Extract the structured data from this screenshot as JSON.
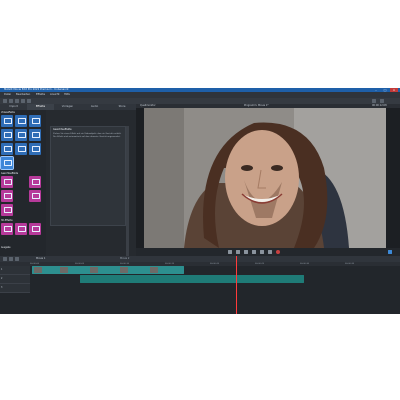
{
  "window": {
    "title": "MAGIX Movie Edit Pro 2022 Premium - Unbenannt",
    "min": "–",
    "max": "□",
    "close": "×"
  },
  "menu": [
    "Datei",
    "Bearbeiten",
    "Effekte",
    "Ansicht",
    "Hilfe"
  ],
  "media_tabs": [
    "Import",
    "Effekte",
    "Vorlagen",
    "Audio",
    "Store"
  ],
  "media_tab_active": 1,
  "sections": {
    "video_effects": "Videoeffekte",
    "face_effects": "Gesichtseffekte",
    "more": "3D-Effekte",
    "bottom_label": "Ausgabe"
  },
  "info_panel": {
    "title": "Gesichtseffekte",
    "text": "Ziehen Sie einen Effekt auf ein Videoobjekt, das ein Gesicht enthält. Der Effekt wird automatisch auf das erkannte Gesicht angewendet."
  },
  "preview": {
    "left_label": "Quellmonitor",
    "title": "Programm: Movie 1*",
    "timecode": "00:00:12:08"
  },
  "timeline": {
    "ruler": [
      "00:00:00",
      "00:00:05",
      "00:00:10",
      "00:00:15",
      "00:00:20",
      "00:00:25",
      "00:00:30",
      "00:00:35"
    ],
    "tracks": [
      "1",
      "2",
      "3"
    ],
    "tabs": [
      "Movie 1",
      "Movie 2"
    ]
  },
  "colors": {
    "accent": "#1e5fa8",
    "clip": "#2d8f8f",
    "face_tile": "#b63a9a",
    "effect_tile": "#2f6db6"
  }
}
